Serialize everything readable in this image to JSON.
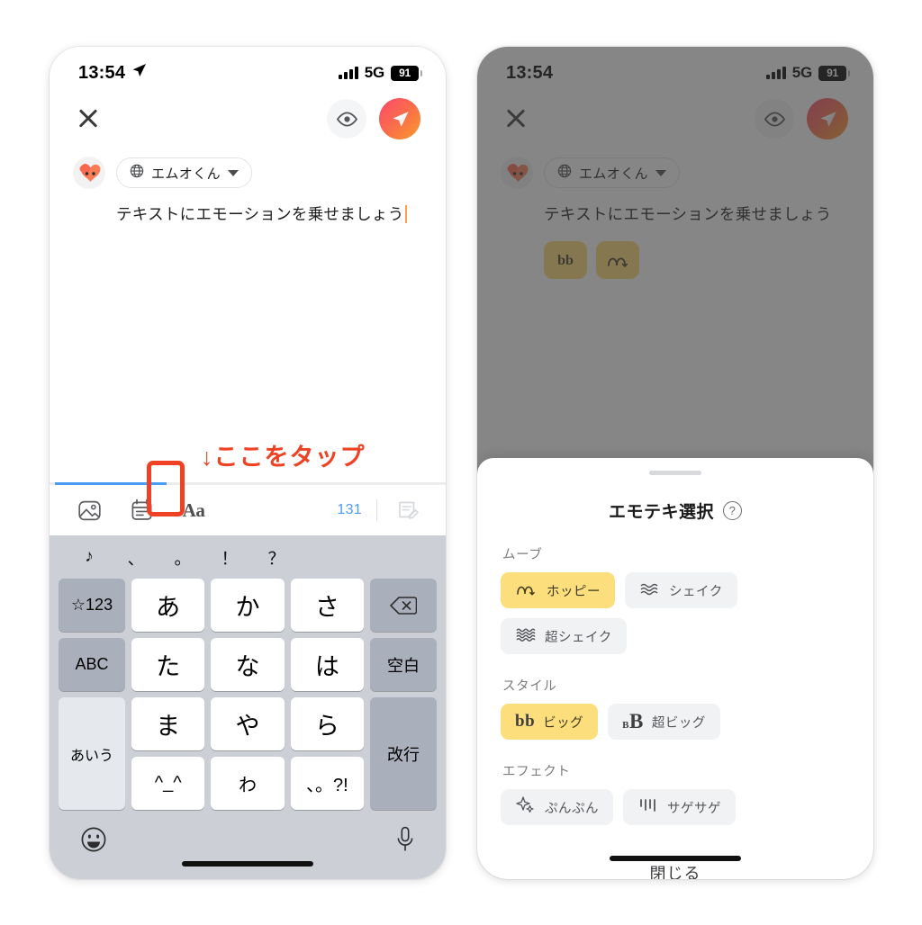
{
  "status_bar": {
    "time": "13:54",
    "network": "5G",
    "battery": "91",
    "location_icon": "location-arrow-icon"
  },
  "header": {
    "close_icon": "close-icon",
    "preview_icon": "eye-icon",
    "send_icon": "send-paper-plane-icon"
  },
  "composer": {
    "avatar_name": "avatar",
    "account_label": "エムオくん",
    "globe_icon": "globe-icon",
    "caret_icon": "chevron-down-icon",
    "text": "テキストにエモーションを乗せましょう",
    "emoteki_badges": [
      {
        "name": "style-big-badge",
        "glyph": "bb"
      },
      {
        "name": "move-hoppy-badge",
        "glyph": "hop"
      }
    ]
  },
  "annotation": {
    "tap_here": "↓ここをタップ",
    "color": "#EF4123"
  },
  "toolbar": {
    "icons": [
      {
        "name": "image-icon",
        "label": ""
      },
      {
        "name": "calendar-icon",
        "label": ""
      },
      {
        "name": "text-format-icon",
        "label": "Aa"
      }
    ],
    "char_count": "131",
    "draft_icon": "draft-note-icon",
    "active_tab_color": "#4a9cf6"
  },
  "keyboard": {
    "suggestions": [
      "♪",
      "、",
      "。",
      "！",
      "？"
    ],
    "rows": [
      [
        {
          "label": "☆123",
          "type": "fn"
        },
        {
          "label": "あ",
          "type": "char"
        },
        {
          "label": "か",
          "type": "char"
        },
        {
          "label": "さ",
          "type": "char"
        },
        {
          "label": "delete-icon",
          "type": "fn"
        }
      ],
      [
        {
          "label": "ABC",
          "type": "fn"
        },
        {
          "label": "た",
          "type": "char"
        },
        {
          "label": "な",
          "type": "char"
        },
        {
          "label": "は",
          "type": "char"
        },
        {
          "label": "空白",
          "type": "fn"
        }
      ],
      [
        {
          "label": "あいう",
          "type": "fn-light"
        },
        {
          "label": "ま",
          "type": "char"
        },
        {
          "label": "や",
          "type": "char"
        },
        {
          "label": "ら",
          "type": "char"
        },
        {
          "label": "改行",
          "type": "fn"
        }
      ],
      [
        {
          "label": "^_^",
          "type": "char-small"
        },
        {
          "label": "わ",
          "type": "char-small"
        },
        {
          "label": "、。?!",
          "type": "char-small"
        }
      ]
    ],
    "emoji_icon": "emoji-smiley-icon",
    "mic_icon": "microphone-icon"
  },
  "sheet": {
    "title": "エモテキ選択",
    "help_icon": "help-question-icon",
    "sections": [
      {
        "label": "ムーブ",
        "options": [
          {
            "label": "ホッピー",
            "icon": "hop-arc-icon",
            "selected": true
          },
          {
            "label": "シェイク",
            "icon": "wave-lines-icon",
            "selected": false
          },
          {
            "label": "超シェイク",
            "icon": "wave-lines-dense-icon",
            "selected": false
          }
        ]
      },
      {
        "label": "スタイル",
        "options": [
          {
            "label": "ビッグ",
            "icon": "bb-glyph-icon",
            "glyph": "bb",
            "selected": true
          },
          {
            "label": "超ビッグ",
            "icon": "bB-glyph-icon",
            "glyph": "BB",
            "selected": false
          }
        ]
      },
      {
        "label": "エフェクト",
        "options": [
          {
            "label": "ぷんぷん",
            "icon": "sparkle-icon",
            "selected": false
          },
          {
            "label": "サゲサゲ",
            "icon": "down-lines-icon",
            "selected": false
          }
        ]
      }
    ],
    "close_label": "閉じる"
  }
}
